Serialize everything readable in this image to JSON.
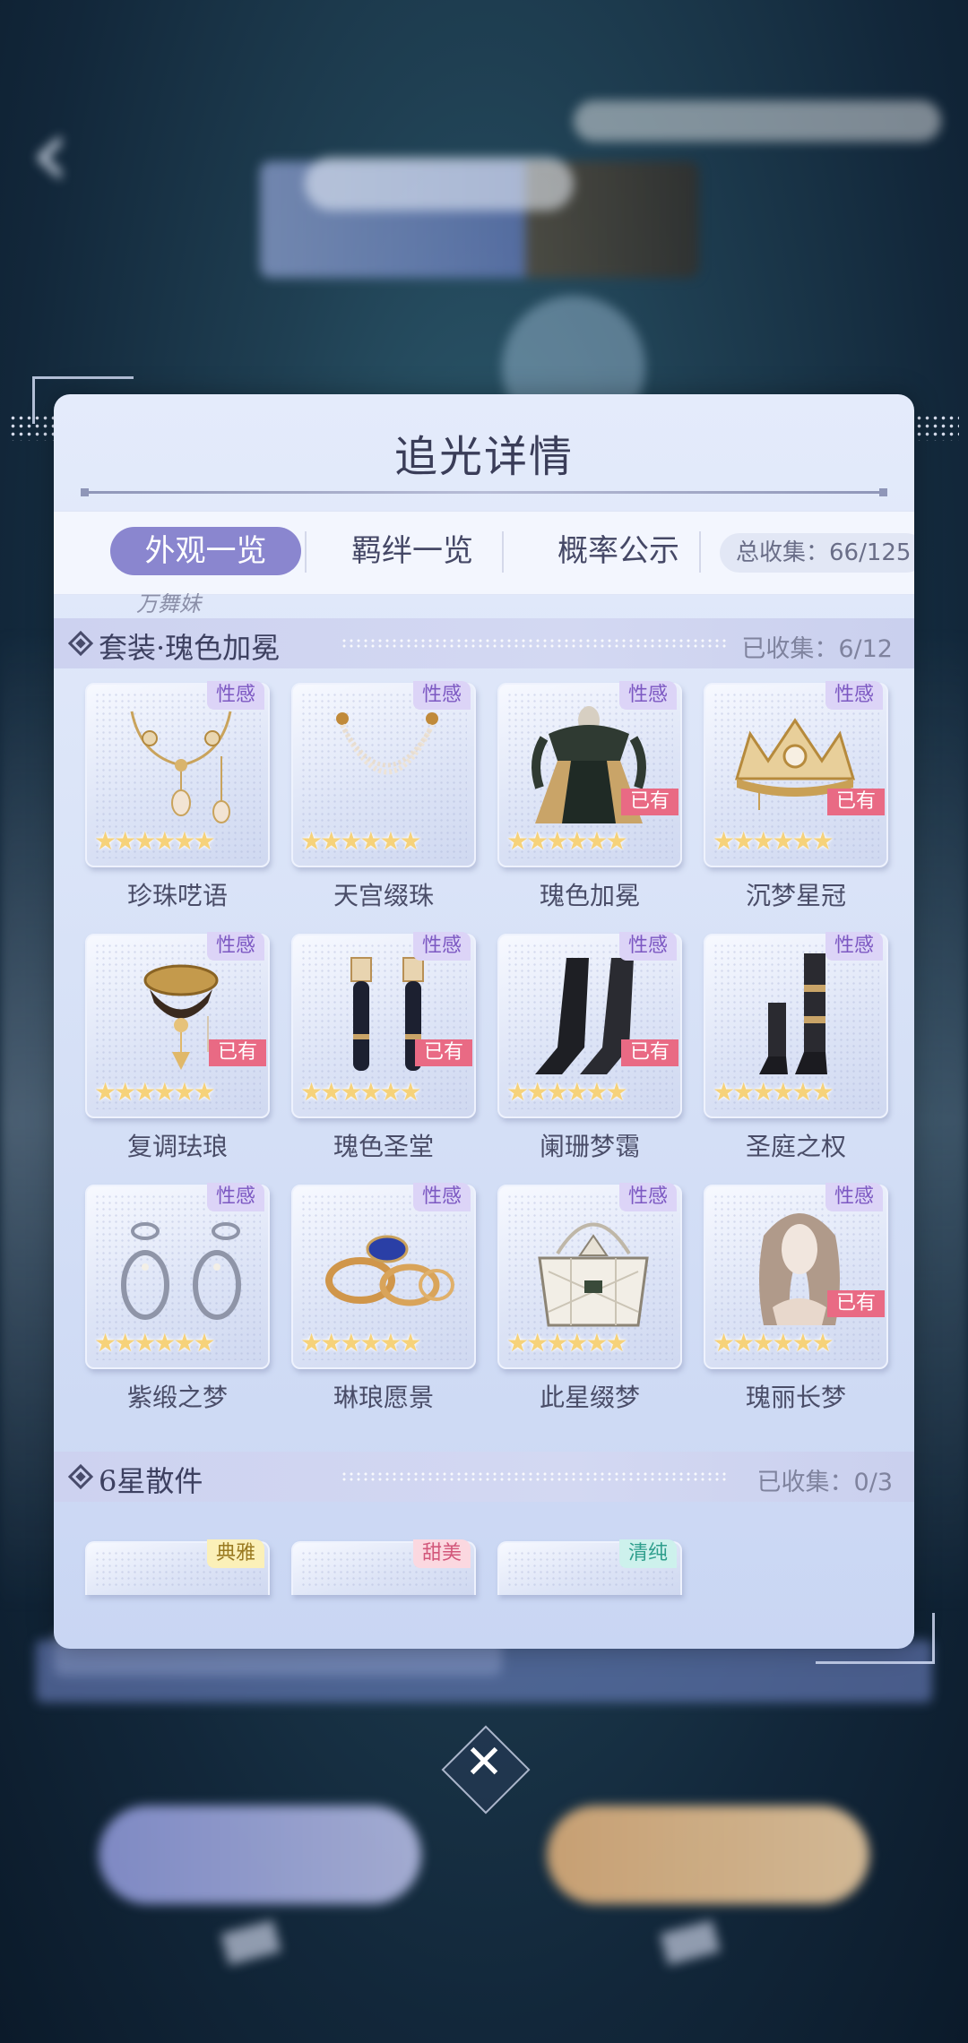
{
  "panel": {
    "title": "追光详情"
  },
  "tabs": [
    {
      "label": "外观一览",
      "active": true
    },
    {
      "label": "羁绊一览",
      "active": false
    },
    {
      "label": "概率公示",
      "active": false
    }
  ],
  "total_collected": "总收集：66/125",
  "prev_section_remnant": "万舞妹",
  "sections": [
    {
      "name": "套装·瑰色加冕",
      "count": "已收集：6/12"
    },
    {
      "name": "6星散件",
      "count": "已收集：0/3"
    }
  ],
  "suit_items": [
    {
      "name": "珍珠呓语",
      "tag": "性感",
      "owned": false,
      "stars": 6,
      "icon": "necklace-icon"
    },
    {
      "name": "天宫缀珠",
      "tag": "性感",
      "owned": false,
      "stars": 6,
      "icon": "pearl-chain-icon"
    },
    {
      "name": "瑰色加冕",
      "tag": "性感",
      "owned": true,
      "owned_label": "已有",
      "stars": 6,
      "icon": "dress-icon"
    },
    {
      "name": "沉梦星冠",
      "tag": "性感",
      "owned": true,
      "owned_label": "已有",
      "stars": 6,
      "icon": "crown-icon"
    },
    {
      "name": "复调珐琅",
      "tag": "性感",
      "owned": true,
      "owned_label": "已有",
      "stars": 6,
      "icon": "choker-icon"
    },
    {
      "name": "瑰色圣堂",
      "tag": "性感",
      "owned": true,
      "owned_label": "已有",
      "stars": 6,
      "icon": "gloves-icon"
    },
    {
      "name": "阑珊梦霭",
      "tag": "性感",
      "owned": true,
      "owned_label": "已有",
      "stars": 6,
      "icon": "stockings-icon"
    },
    {
      "name": "圣庭之权",
      "tag": "性感",
      "owned": false,
      "stars": 6,
      "icon": "boots-icon"
    },
    {
      "name": "紫缎之梦",
      "tag": "性感",
      "owned": false,
      "stars": 6,
      "icon": "bracelets-icon"
    },
    {
      "name": "琳琅愿景",
      "tag": "性感",
      "owned": false,
      "stars": 6,
      "icon": "rings-icon"
    },
    {
      "name": "此星缀梦",
      "tag": "性感",
      "owned": false,
      "stars": 6,
      "icon": "handbag-icon"
    },
    {
      "name": "瑰丽长梦",
      "tag": "性感",
      "owned": true,
      "owned_label": "已有",
      "stars": 6,
      "icon": "hair-icon"
    }
  ],
  "single_items": [
    {
      "tag": "典雅",
      "tag_style": "elegant"
    },
    {
      "tag": "甜美",
      "tag_style": "sweet"
    },
    {
      "tag": "清纯",
      "tag_style": "pure"
    }
  ],
  "stars_glyph": "★★★★★★",
  "close_label": "✕"
}
